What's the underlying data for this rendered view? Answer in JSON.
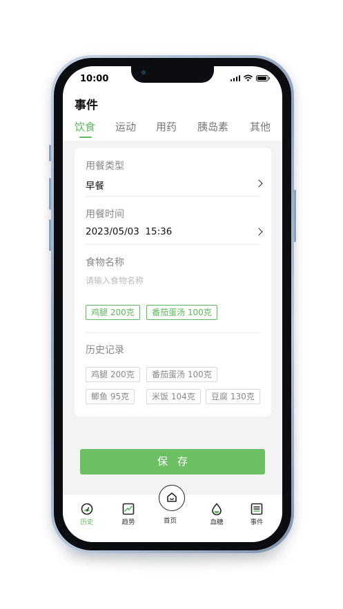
{
  "status_bar": {
    "time": "10:00"
  },
  "header": {
    "title": "事件"
  },
  "tabs": [
    {
      "label": "饮食",
      "active": true
    },
    {
      "label": "运动",
      "active": false
    },
    {
      "label": "用药",
      "active": false
    },
    {
      "label": "胰岛素",
      "active": false
    },
    {
      "label": "其他",
      "active": false
    }
  ],
  "form": {
    "meal_type": {
      "label": "用餐类型",
      "value": "早餐"
    },
    "meal_time": {
      "label": "用餐时间",
      "value": "2023/05/03  15:36"
    },
    "food_name": {
      "label": "食物名称",
      "placeholder": "请输入食物名称"
    },
    "selected_foods": [
      "鸡腿 200克",
      "番茄蛋汤 100克"
    ],
    "history": {
      "label": "历史记录",
      "items": [
        "鸡腿 200克",
        "番茄蛋汤 100克",
        "鲫鱼 95克",
        "米饭 104克",
        "豆腐 130克"
      ]
    }
  },
  "save_button": {
    "label": "保存"
  },
  "bottom_nav": {
    "items": [
      {
        "label": "历史",
        "icon": "history-icon",
        "active": true
      },
      {
        "label": "趋势",
        "icon": "trend-icon",
        "active": false
      },
      {
        "label": "首页",
        "icon": "home-icon",
        "active": false
      },
      {
        "label": "血糖",
        "icon": "blood-drop-icon",
        "active": false
      },
      {
        "label": "事件",
        "icon": "event-list-icon",
        "active": false
      }
    ]
  },
  "colors": {
    "accent": "#5cb85c",
    "button": "#6cbf62",
    "background": "#f3f3f3"
  }
}
